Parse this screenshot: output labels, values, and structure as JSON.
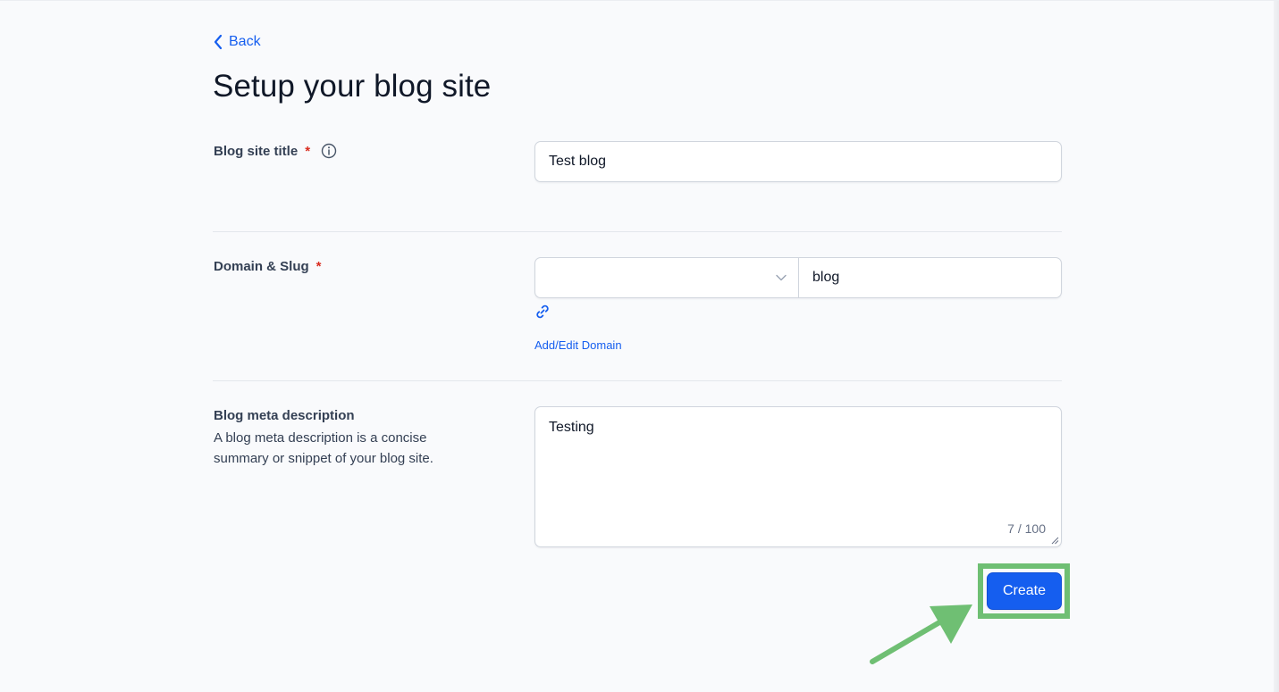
{
  "nav": {
    "back_label": "Back"
  },
  "page": {
    "title": "Setup your blog site"
  },
  "blog_title": {
    "label": "Blog site title",
    "required_mark": "*",
    "value": "Test blog"
  },
  "domain_slug": {
    "label": "Domain & Slug",
    "required_mark": "*",
    "domain_selected": "",
    "slug_value": "blog",
    "add_edit_label": "Add/Edit Domain"
  },
  "meta_description": {
    "label": "Blog meta description",
    "help_text": "A blog meta description is a concise summary or snippet of your blog site.",
    "value": "Testing",
    "char_count": "7 / 100"
  },
  "actions": {
    "create_label": "Create"
  },
  "colors": {
    "primary": "#155eef",
    "required": "#d92d20",
    "annotation": "#6fbf73",
    "background": "#f9fafc"
  },
  "icons": {
    "back": "chevron-left-icon",
    "info": "info-icon",
    "dropdown": "chevron-down-icon",
    "link": "link-icon",
    "annotation_arrow": "arrow-icon"
  }
}
